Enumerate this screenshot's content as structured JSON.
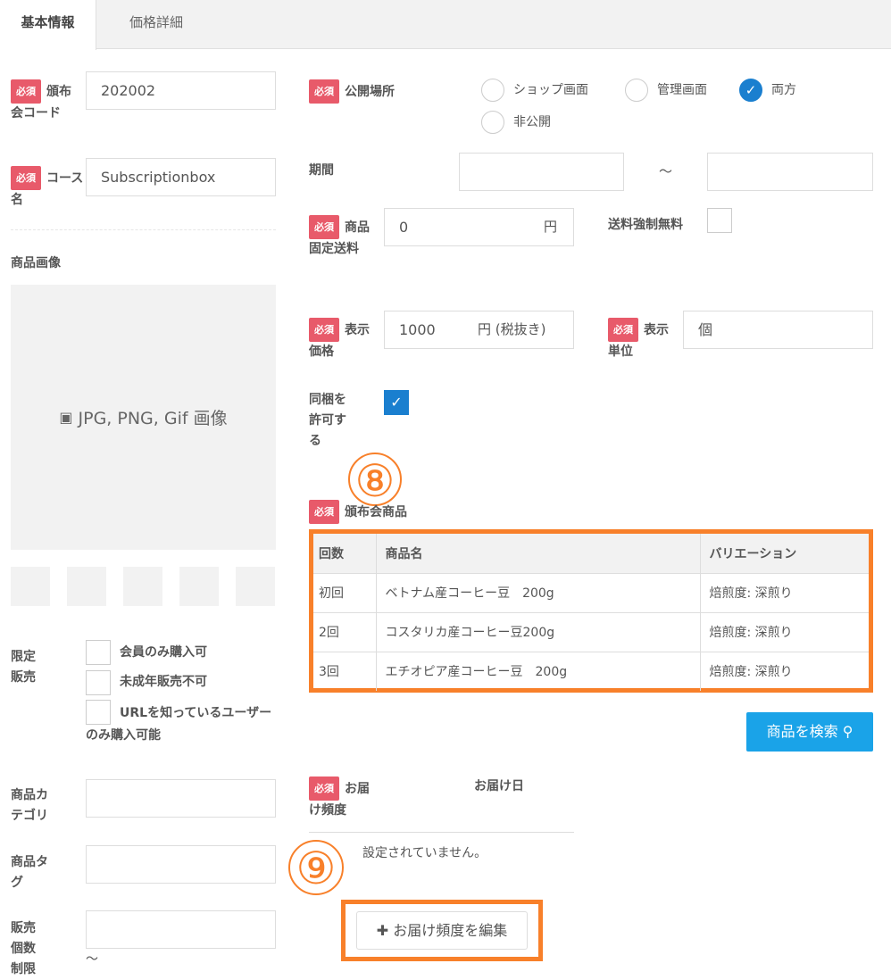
{
  "tabs": [
    {
      "label": "基本情報",
      "active": true
    },
    {
      "label": "価格詳細",
      "active": false
    }
  ],
  "required_badge": "必須",
  "left": {
    "code": {
      "label": "頒布会コード",
      "value": "202002"
    },
    "course": {
      "label": "コース名",
      "value": "Subscriptionbox"
    },
    "image": {
      "label": "商品画像",
      "placeholder": "JPG, PNG, Gif 画像",
      "icon": "image-icon"
    },
    "limited": {
      "label": "限定販売",
      "options": [
        {
          "label": "会員のみ購入可",
          "checked": false
        },
        {
          "label": "未成年販売不可",
          "checked": false
        },
        {
          "label": "URLを知っているユーザーのみ購入可能",
          "checked": false
        }
      ]
    },
    "category": {
      "label": "商品カテゴリ",
      "value": ""
    },
    "tag": {
      "label": "商品タグ",
      "value": ""
    },
    "sales_limit": {
      "label": "販売個数制限",
      "value": "",
      "tilde": "〜"
    }
  },
  "right": {
    "publish": {
      "label": "公開場所",
      "options": [
        {
          "label": "ショップ画面",
          "selected": false
        },
        {
          "label": "管理画面",
          "selected": false
        },
        {
          "label": "両方",
          "selected": true
        },
        {
          "label": "非公開",
          "selected": false
        }
      ]
    },
    "period": {
      "label": "期間",
      "from": "",
      "to": "",
      "sep": "〜"
    },
    "shipping": {
      "label": "商品固定送料",
      "value": "0",
      "unit": "円"
    },
    "free_shipping": {
      "label": "送料強制無料",
      "checked": false
    },
    "price": {
      "label": "表示価格",
      "value": "1000",
      "unit": "円 (税抜き)"
    },
    "unit": {
      "label": "表示単位",
      "value": "個"
    },
    "bundle": {
      "label": "同梱を許可する",
      "checked": true
    },
    "products": {
      "label": "頒布会商品",
      "annotation": "⑧",
      "headers": [
        "回数",
        "商品名",
        "バリエーション"
      ],
      "rows": [
        [
          "初回",
          "ベトナム産コーヒー豆　200g",
          "焙煎度: 深煎り"
        ],
        [
          "2回",
          "コスタリカ産コーヒー豆200g",
          "焙煎度: 深煎り"
        ],
        [
          "3回",
          "エチオピア産コーヒー豆　200g",
          "焙煎度: 深煎り"
        ]
      ]
    },
    "search_button": "商品を検索",
    "delivery": {
      "label": "お届け頻度",
      "date_header": "お届け日",
      "empty": "設定されていません。",
      "annotation": "⑨",
      "edit_button": "お届け頻度を編集"
    }
  },
  "colors": {
    "badge": "#e85a6a",
    "accent": "#f8802a",
    "primary": "#1aa3e8",
    "check": "#1a7fcf"
  }
}
